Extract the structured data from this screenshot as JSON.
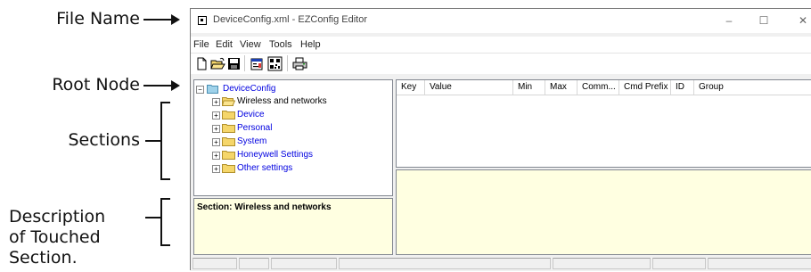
{
  "annotations": {
    "file_name": "File Name",
    "root_node": "Root Node",
    "sections": "Sections",
    "description": [
      "Description",
      "of Touched",
      "Section."
    ]
  },
  "window": {
    "title": "DeviceConfig.xml - EZConfig Editor",
    "buttons": {
      "minimize": "–",
      "maximize": "☐",
      "close": "✕"
    }
  },
  "menu": [
    "File",
    "Edit",
    "View",
    "Tools",
    "Help"
  ],
  "toolbar": [
    "new-file-icon",
    "open-folder-icon",
    "save-disk-icon",
    "properties-icon",
    "barcode-icon",
    "print-config-icon"
  ],
  "tree": {
    "root": "DeviceConfig",
    "sections": [
      "Wireless and networks",
      "Device",
      "Personal",
      "System",
      "Honeywell Settings",
      "Other settings"
    ],
    "selected": "Wireless and networks"
  },
  "description_pane": {
    "text": "Section: Wireless and networks"
  },
  "grid": {
    "columns": [
      "Key",
      "Value",
      "Min",
      "Max",
      "Comm...",
      "Cmd Prefix",
      "ID",
      "Group"
    ]
  },
  "colors": {
    "folder": "#f5d66a",
    "info_pane": "#ffffe1",
    "link_text": "#0000e0"
  }
}
